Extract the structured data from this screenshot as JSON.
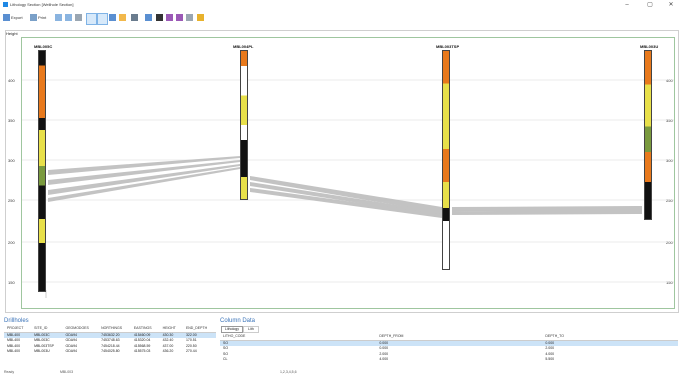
{
  "window": {
    "title": "Lithology Section [Wellhole Section]",
    "minimize": "–",
    "maximize": "▢",
    "close": "✕"
  },
  "toolbar": {
    "export_label": "Export",
    "print_label": "Print"
  },
  "chart": {
    "y_axis_label": "Height",
    "y_ticks": [
      "400",
      "350",
      "300",
      "250",
      "200",
      "150"
    ],
    "wells": [
      "MBL005C",
      "MBL004PL",
      "MBL003TSP",
      "MBL003U"
    ],
    "series_colors": {
      "black": "#111111",
      "orange": "#e8791c",
      "yellow": "#e8e04a",
      "green": "#7a9a3e",
      "white": "#ffffff",
      "correlation": "#bdbdbd"
    }
  },
  "drillholes": {
    "title": "Drillholes",
    "columns": [
      "PROJECT",
      "SITE_ID",
      "GEOMODOES",
      "NORTHINGS",
      "EASTINGS",
      "HEIGHT",
      "END_DEPTH"
    ],
    "rows": [
      [
        "MBL400",
        "MBL003C",
        "GDA94",
        "7453632.20",
        "415460.09",
        "430.30",
        "322.00"
      ],
      [
        "MBL400",
        "MBL003C",
        "GDA94",
        "7453748.63",
        "415320.04",
        "432.40",
        "170.51"
      ],
      [
        "MBL400",
        "MBL003TSP",
        "GDA94",
        "7454218.44",
        "415568.59",
        "437.00",
        "220.50"
      ],
      [
        "MBL400",
        "MBL003U",
        "GDA94",
        "7454025.80",
        "415575.03",
        "436.20",
        "270.44"
      ]
    ],
    "footer_left": "Ready",
    "footer_mid": "MBL003"
  },
  "column_data": {
    "title": "Column Data",
    "tabs": [
      "Lithology",
      "Lith"
    ],
    "columns": [
      "LITHO_CODE",
      "DEPTH_FROM",
      "DEPTH_TO"
    ],
    "rows": [
      [
        "SO",
        "0.000",
        "0.000"
      ],
      [
        "SO",
        "0.000",
        "2.000"
      ],
      [
        "SO",
        "2.000",
        "4.000"
      ],
      [
        "CL",
        "4.000",
        "5.500"
      ]
    ],
    "footer": "1,2,3,4,5,6"
  }
}
